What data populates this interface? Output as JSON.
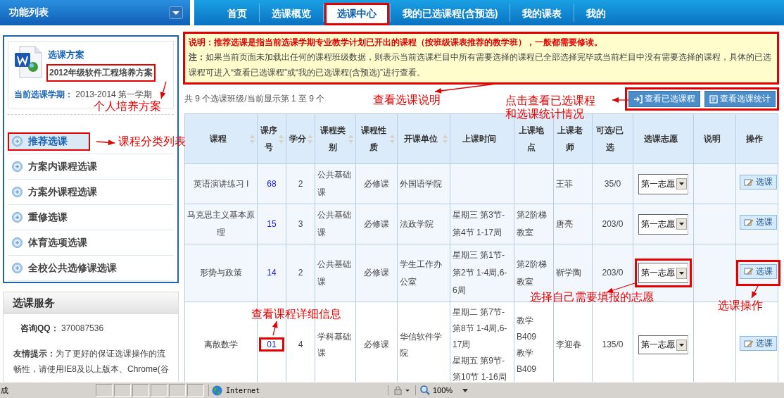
{
  "header": {
    "title": "功能列表"
  },
  "tabs": [
    {
      "label": "首页",
      "selected": false
    },
    {
      "label": "选课概览",
      "selected": false
    },
    {
      "label": "选课中心",
      "selected": true
    },
    {
      "label": "我的已选课程(含预选)",
      "selected": false
    },
    {
      "label": "我的课表",
      "selected": false
    },
    {
      "label": "我的",
      "selected": false
    }
  ],
  "plan": {
    "title": "选课方案",
    "name": "2012年级软件工程培养方案",
    "name_highlighted": true,
    "term_label": "当前选课学期：",
    "term": "2013-2014 第一学期"
  },
  "categories": [
    {
      "label": "推荐选课",
      "selected": true
    },
    {
      "label": "方案内课程选课",
      "selected": false
    },
    {
      "label": "方案外课程选课",
      "selected": false
    },
    {
      "label": "重修选课",
      "selected": false
    },
    {
      "label": "体育选项选课",
      "selected": false
    },
    {
      "label": "全校公共选修课选课",
      "selected": false
    }
  ],
  "service": {
    "title": "选课服务",
    "qq_label": "咨询QQ：",
    "qq": "370087536",
    "tip": "**友情提示：**为了更好的保证选课操作的流畅性，请使用IE8及以上版本、Chrome(谷"
  },
  "notice": {
    "highlighted": true,
    "lines": [
      {
        "kind": "important",
        "text": "说明：推荐选课是指当前选课学期专业教学计划已开出的课程（按班级课表推荐的教学班），一般都需要修读。"
      },
      {
        "kind": "note",
        "text": "**注：**如果当前页面未加载出任何的课程班级数据，则表示当前选课栏目中所有需要选择的课程已全部选择完毕或当前栏目中没有需要选择的课程，具体的已选课程可进入“查看已选课程”或“我的已选课程(含预选)”进行查看。"
      }
    ]
  },
  "summary": "共 9 个选课班级/当前显示第 1 至 9 个",
  "toolbar": {
    "highlighted": true,
    "buttons": [
      {
        "kind": "selected",
        "label": "查看已选课程"
      },
      {
        "kind": "stats",
        "label": "查看选课统计"
      }
    ]
  },
  "table": {
    "columns": [
      {
        "label": "课程",
        "sortable": true
      },
      {
        "label": "课序号",
        "sortable": true
      },
      {
        "label": "学分",
        "sortable": true
      },
      {
        "label": "课程类别",
        "sortable": true
      },
      {
        "label": "课程性质",
        "sortable": true
      },
      {
        "label": "开课单位",
        "sortable": true
      },
      {
        "label": "上课时间",
        "sortable": false
      },
      {
        "label": "上课地点",
        "sortable": false
      },
      {
        "label": "上课老师",
        "sortable": false
      },
      {
        "label": "可选/已选",
        "sortable": false
      },
      {
        "label": "选课志愿",
        "sortable": false
      },
      {
        "label": "说明",
        "sortable": false
      },
      {
        "label": "操作",
        "sortable": false
      }
    ],
    "rows": [
      {
        "course": "英语演讲练习 I",
        "seq": "68",
        "seq_highlighted": false,
        "credit": "2",
        "category": "公共基础课",
        "nature": "必修课",
        "unit": "外国语学院",
        "time": [],
        "location": [],
        "teacher": "王菲",
        "capacity": "35/0",
        "wish": "第一志愿",
        "wish_highlighted": false,
        "action": "选课",
        "action_highlighted": false
      },
      {
        "course": "马克思主义基本原理",
        "seq": "15",
        "seq_highlighted": false,
        "credit": "3",
        "category": "公共基础课",
        "nature": "必修课",
        "unit": "法政学院",
        "time": [
          "星期三 第3节-第4节 1-17周"
        ],
        "location": [
          "第2阶梯教室"
        ],
        "teacher": "唐亮",
        "capacity": "203/0",
        "wish": "第一志愿",
        "wish_highlighted": false,
        "action": "选课",
        "action_highlighted": false
      },
      {
        "course": "形势与政策",
        "seq": "14",
        "seq_highlighted": false,
        "credit": "2",
        "category": "公共基础课",
        "nature": "必修课",
        "unit": "学生工作办公室",
        "time": [
          "星期三 第1节-第2节 1-4周,6-6周"
        ],
        "location": [
          "第2阶梯教室"
        ],
        "teacher": "靳学陶",
        "capacity": "203/0",
        "wish": "第一志愿",
        "wish_highlighted": true,
        "action": "选课",
        "action_highlighted": true
      },
      {
        "course": "离散数学",
        "seq": "01",
        "seq_highlighted": true,
        "credit": "4",
        "category": "学科基础课",
        "nature": "必修课",
        "unit": "华信软件学院",
        "time": [
          "星期二 第7节-第8节 1-4周,6-17周",
          "星期五 第9节-第10节 1-16周"
        ],
        "location": [
          "教学B409",
          "教学B409"
        ],
        "teacher": "李迎春",
        "capacity": "135/0",
        "wish": "第一志愿",
        "wish_highlighted": false,
        "action": "选课",
        "action_highlighted": false
      }
    ]
  },
  "annotations": [
    {
      "lines": [
        "个人培养方案"
      ]
    },
    {
      "lines": [
        "课程分类列表"
      ]
    },
    {
      "lines": [
        "查看选课说明"
      ]
    },
    {
      "lines": [
        "点击查看已选课程",
        "和选课统计情况"
      ]
    },
    {
      "lines": [
        "查看课程详细信息"
      ]
    },
    {
      "lines": [
        "选择自己需要填报的志愿"
      ]
    },
    {
      "lines": [
        "选课操作"
      ]
    }
  ],
  "status_bar": {
    "text": "成",
    "zone": "Internet",
    "zoom": "100%"
  }
}
